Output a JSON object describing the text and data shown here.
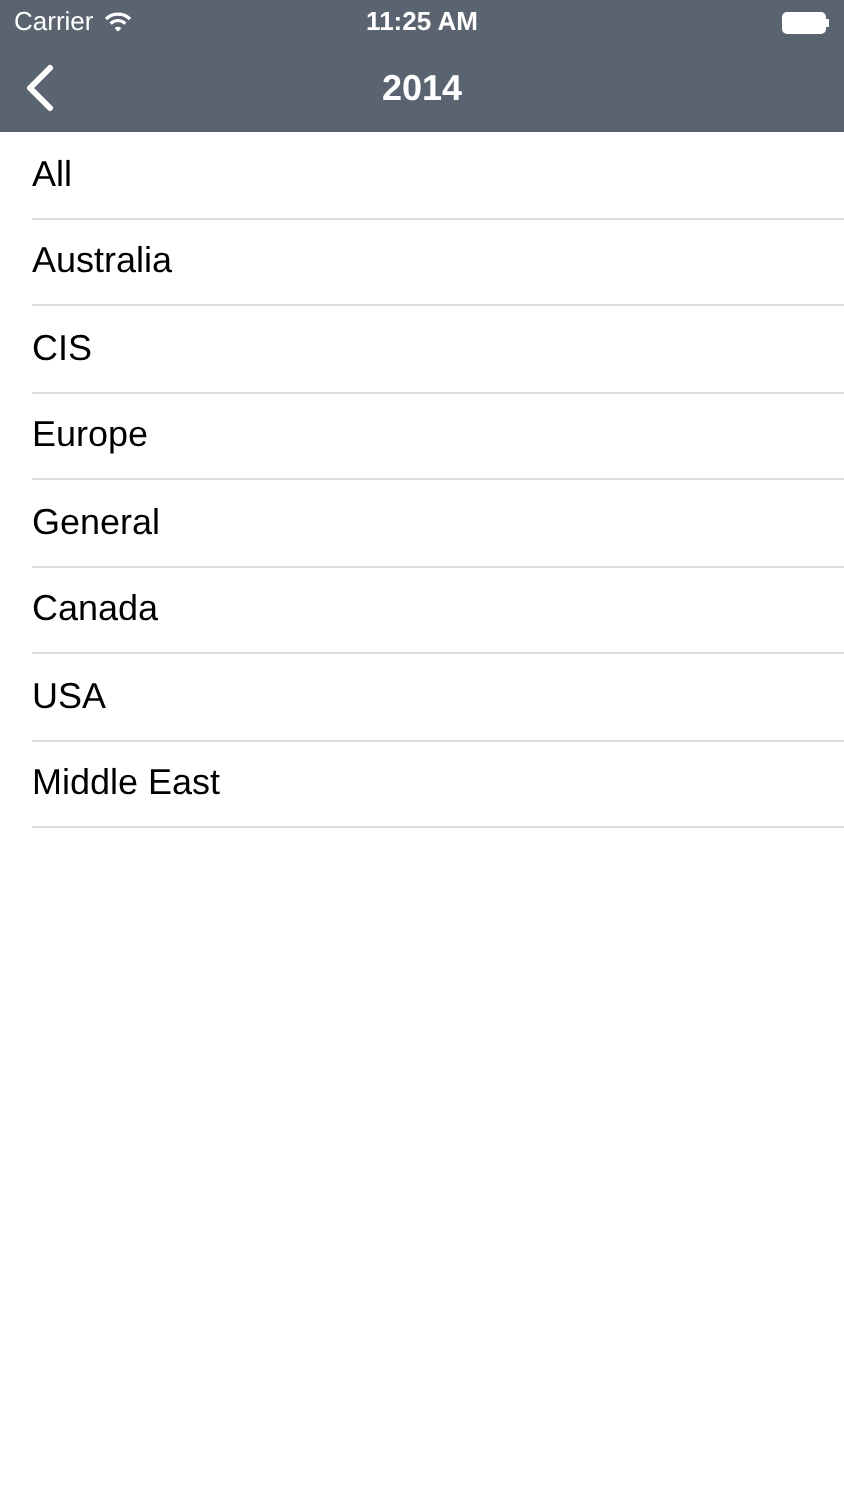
{
  "status_bar": {
    "carrier": "Carrier",
    "time": "11:25 AM"
  },
  "nav_bar": {
    "title": "2014"
  },
  "items": [
    {
      "label": "All"
    },
    {
      "label": "Australia"
    },
    {
      "label": "CIS"
    },
    {
      "label": "Europe"
    },
    {
      "label": "General"
    },
    {
      "label": "Canada"
    },
    {
      "label": "USA"
    },
    {
      "label": "Middle East"
    }
  ]
}
